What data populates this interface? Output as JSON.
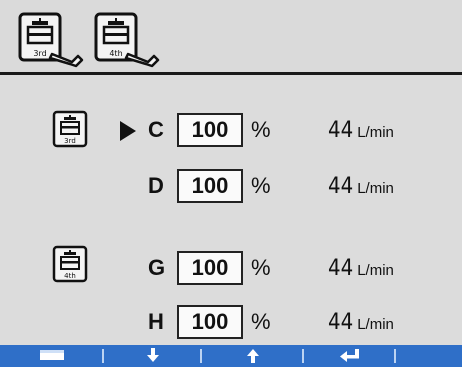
{
  "header": {
    "buttons": [
      {
        "icon": "dispenser-wrench-3rd-icon",
        "sublabel": "3rd"
      },
      {
        "icon": "dispenser-wrench-4th-icon",
        "sublabel": "4th"
      }
    ]
  },
  "groups": [
    {
      "icon_sublabel": "3rd",
      "rows": [
        {
          "letter": "C",
          "value": "100",
          "unit": "%",
          "flow": "44",
          "flow_unit": "L/min",
          "selected": true
        },
        {
          "letter": "D",
          "value": "100",
          "unit": "%",
          "flow": "44",
          "flow_unit": "L/min",
          "selected": false
        }
      ]
    },
    {
      "icon_sublabel": "4th",
      "rows": [
        {
          "letter": "G",
          "value": "100",
          "unit": "%",
          "flow": "44",
          "flow_unit": "L/min",
          "selected": false
        },
        {
          "letter": "H",
          "value": "100",
          "unit": "%",
          "flow": "44",
          "flow_unit": "L/min",
          "selected": false
        }
      ]
    }
  ],
  "softkeys": [
    {
      "icon": "screen-icon"
    },
    {
      "icon": "arrow-down-icon"
    },
    {
      "icon": "arrow-up-icon"
    },
    {
      "icon": "enter-icon"
    },
    {
      "icon": "blank"
    }
  ],
  "colors": {
    "softbar": "#2f6fc8",
    "background": "#dcdcdc"
  }
}
